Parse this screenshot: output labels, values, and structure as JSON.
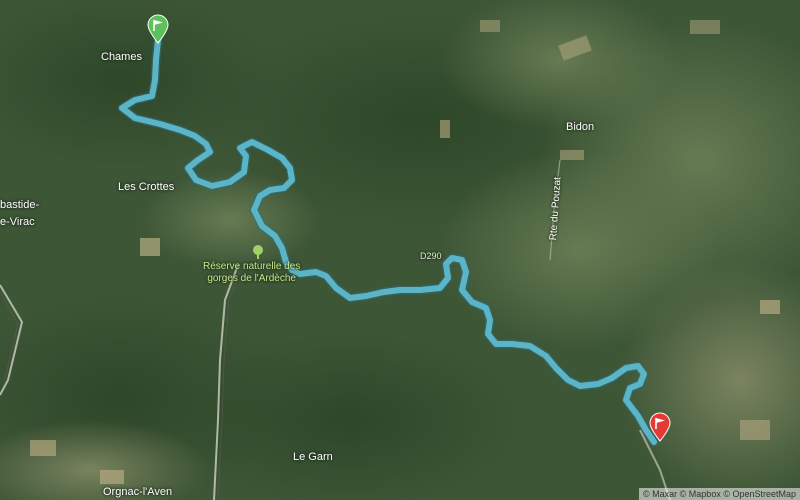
{
  "map": {
    "route_color": "#5bb5c7",
    "start_marker": {
      "icon": "start-flag-icon",
      "color": "#5cc05c"
    },
    "end_marker": {
      "icon": "finish-flag-icon",
      "color": "#e53935"
    },
    "places": {
      "chames": "Chames",
      "les_crottes": "Les Crottes",
      "bidon": "Bidon",
      "bastide_line1": "bastide-",
      "bastide_line2": "e-Virac",
      "reserve_line1": "Réserve naturelle des",
      "reserve_line2": "gorges de l'Ardèche",
      "rte_du_pouzat": "Rte du Pouzat",
      "le_garn": "Le Garn",
      "orgnac": "Orgnac-l'Aven",
      "road_d290": "D290"
    },
    "attribution": "© Maxar © Mapbox © OpenStreetMap"
  }
}
